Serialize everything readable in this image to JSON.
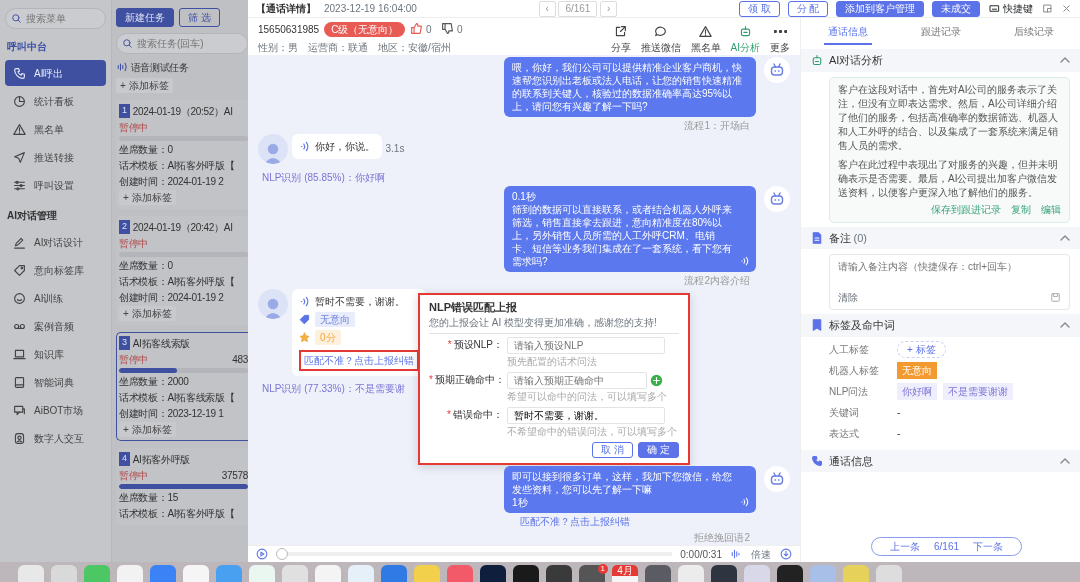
{
  "left_app": {
    "menu_search": {
      "placeholder": "搜索菜单"
    },
    "menu_sections": [
      {
        "title": "呼叫中台",
        "items": [
          {
            "label": "AI呼出",
            "selected": true
          },
          {
            "label": "统计看板",
            "selected": false
          },
          {
            "label": "黑名单",
            "selected": false
          },
          {
            "label": "推送转接",
            "selected": false
          },
          {
            "label": "呼叫设置",
            "selected": false
          }
        ]
      },
      {
        "title": "AI对话管理",
        "items": [
          {
            "label": "AI对话设计",
            "selected": false
          },
          {
            "label": "意向标签库",
            "selected": false
          },
          {
            "label": "AI训练",
            "selected": false
          },
          {
            "label": "案例音频",
            "selected": false
          },
          {
            "label": "知识库",
            "selected": false
          },
          {
            "label": "智能词典",
            "selected": false
          },
          {
            "label": "AiBOT市场",
            "selected": false
          },
          {
            "label": "数字人交互",
            "selected": false
          }
        ]
      }
    ],
    "task_panel": {
      "buttons": [
        {
          "label": "新建任务",
          "kind": "solid"
        },
        {
          "label": "筛 选",
          "kind": "outline"
        }
      ],
      "search": {
        "placeholder": "搜索任务(回车)"
      },
      "voice_task": {
        "title": "语音测试任务",
        "add_tag": "+ 添加标签"
      },
      "tasks": [
        {
          "index": "1",
          "title": "2024-01-19（20:52）AI",
          "status": "暂停中",
          "level": 0,
          "selected": false,
          "details": [
            "坐席数量：0",
            "话术模板：AI拓客外呼版【",
            "创建时间：2024-01-19 2"
          ],
          "add_tag": "+ 添加标签"
        },
        {
          "index": "2",
          "title": "2024-01-19（20:42）AI",
          "status": "暂停中",
          "level": 0,
          "selected": false,
          "details": [
            "坐席数量：0",
            "话术模板：AI拓客外呼版【",
            "创建时间：2024-01-19 2"
          ],
          "add_tag": "+ 添加标签"
        },
        {
          "index": "3",
          "title": "AI拓客线索版",
          "status": "暂停中",
          "count": "483",
          "level": 0.45,
          "selected": true,
          "details": [
            "坐席数量：2000",
            "话术模板：AI拓客线索版【",
            "创建时间：2023-12-19 1"
          ],
          "add_tag": "+ 添加标签"
        },
        {
          "index": "4",
          "title": "AI拓客外呼版",
          "status": "暂停中",
          "count": "37578",
          "level": 1,
          "selected": false,
          "details": [
            "坐席数量：15",
            "话术模板：AI拓客外呼版【"
          ]
        }
      ]
    }
  },
  "header": {
    "title": "【通话详情】",
    "time": "2023-12-19 16:04:00",
    "pager": {
      "prev": "‹",
      "position": "6/161",
      "next": "›"
    },
    "buttons": [
      {
        "label": "领 取",
        "kind": "outline"
      },
      {
        "label": "分 配",
        "kind": "outline"
      },
      {
        "label": "添加到客户管理",
        "kind": "solid"
      },
      {
        "label": "未成交",
        "kind": "solid"
      }
    ],
    "shortcut": "快捷键"
  },
  "customer": {
    "phone": "15650631985",
    "grade": "C级（无意向）",
    "likes": "0",
    "dislikes": "0",
    "meta": [
      "性别：男",
      "运营商：联通",
      "地区：安徽/宿州"
    ],
    "actions": [
      {
        "label": "分享",
        "selected": false
      },
      {
        "label": "推送微信",
        "selected": false
      },
      {
        "label": "黑名单",
        "selected": false
      },
      {
        "label": "AI分析",
        "selected": true
      },
      {
        "label": "更多",
        "selected": false
      }
    ]
  },
  "dialogue": [
    {
      "kind": "bot",
      "text": "喂，你好，我们公司可以提供精准企业客户商机，快速帮您识别出老板或法人电话，让您的销售快速精准的联系到关键人，核验过的数据准确率高达95%以上，请问您有兴趣了解一下吗?",
      "playable": false,
      "caption": "流程1：开场白"
    },
    {
      "kind": "customer",
      "text": "你好，你说。",
      "duration": "3.1s",
      "caption": "NLP识别 (85.85%)：你好啊"
    },
    {
      "kind": "bot",
      "lead": "0.1秒",
      "text": "筛到的数据可以直接联系，或者结合机器人外呼来筛选，销售直接拿去跟进，意向精准度在80%以上，另外销售人员所需的人工外呼CRM、电销卡、短信等业务我们集成在了一套系统，看下您有需求吗?",
      "playable": true,
      "caption": "流程2内容介绍"
    },
    {
      "kind": "customer",
      "text": "暂时不需要，谢谢。",
      "intent_tag": "无意向",
      "score": "0分",
      "report_link": "匹配不准？点击上报纠错",
      "annotated": true,
      "caption": "NLP识别 (77.33%)：不是需要谢"
    },
    {
      "kind": "bot",
      "text": "即可以接到很多订单，这样，我加下您微信，给您发些资料，您可以先了解一下嘛",
      "trail": "1秒",
      "playable": true,
      "report_link": "匹配不准？点击上报纠错",
      "caption": "拒绝挽回语2"
    }
  ],
  "report_dialog": {
    "title": "NLP错误匹配上报",
    "subtitle": "您的上报会让 AI 模型变得更加准确，感谢您的支持!",
    "annotated": true,
    "fields": [
      {
        "marker": "*",
        "label": "预设NLP：",
        "placeholder": "请输入预设NLP",
        "hint": "预先配置的话术问法",
        "addable": false
      },
      {
        "marker": "*",
        "label": "预期正确命中：",
        "placeholder": "请输入预期正确命中",
        "hint": "希望可以命中的问法，可以填写多个",
        "addable": true
      },
      {
        "marker": "*",
        "label": "错误命中：",
        "value": "暂时不需要，谢谢。",
        "hint": "不希望命中的错误问法，可以填写多个",
        "addable": false
      }
    ],
    "buttons": [
      {
        "label": "取 消",
        "kind": "outline"
      },
      {
        "label": "确 定",
        "kind": "solid"
      }
    ]
  },
  "player": {
    "time": "0:00/0:31",
    "speed": "倍速",
    "level": 0
  },
  "info_tabs": [
    {
      "label": "通话信息",
      "selected": true
    },
    {
      "label": "跟进记录",
      "selected": false
    },
    {
      "label": "后续记录",
      "selected": false
    }
  ],
  "ai_analysis": {
    "title": "AI对话分析",
    "paragraphs": [
      "客户在这段对话中，首先对AI公司的服务表示了关注，但没有立即表达需求。然后，AI公司详细介绍了他们的服务，包括高准确率的数据筛选、机器人和人工外呼的结合、以及集成了一套系统来满足销售人员的需求。",
      "客户在此过程中表现出了对服务的兴趣，但并未明确表示是否需要。最后，AI公司提出加客户微信发送资料，以便客户更深入地了解他们的服务。"
    ],
    "actions": [
      "保存到跟进记录",
      "复制",
      "编辑"
    ]
  },
  "notes": {
    "title": "备注",
    "count": "(0)",
    "placeholder": "请输入备注内容（快捷保存：ctrl+回车）",
    "clear": "清除"
  },
  "tags": {
    "title": "标签及命中词",
    "rows": [
      {
        "label": "人工标签",
        "kind": "add",
        "values": [
          "+ 标签"
        ]
      },
      {
        "label": "机器人标签",
        "kind": "robot",
        "values": [
          "无意向"
        ]
      },
      {
        "label": "NLP问法",
        "kind": "nlp",
        "values": [
          "你好啊",
          "不是需要谢谢"
        ]
      },
      {
        "label": "关键词",
        "kind": "text",
        "values": [
          "-"
        ]
      },
      {
        "label": "表达式",
        "kind": "text",
        "values": [
          "-"
        ]
      }
    ]
  },
  "call_info": {
    "title": "通话信息"
  },
  "record_nav": {
    "prev": "上一条",
    "position": "6/161",
    "next": "下一条"
  },
  "dock": {
    "badge": "1",
    "calendar_month": "4月"
  }
}
